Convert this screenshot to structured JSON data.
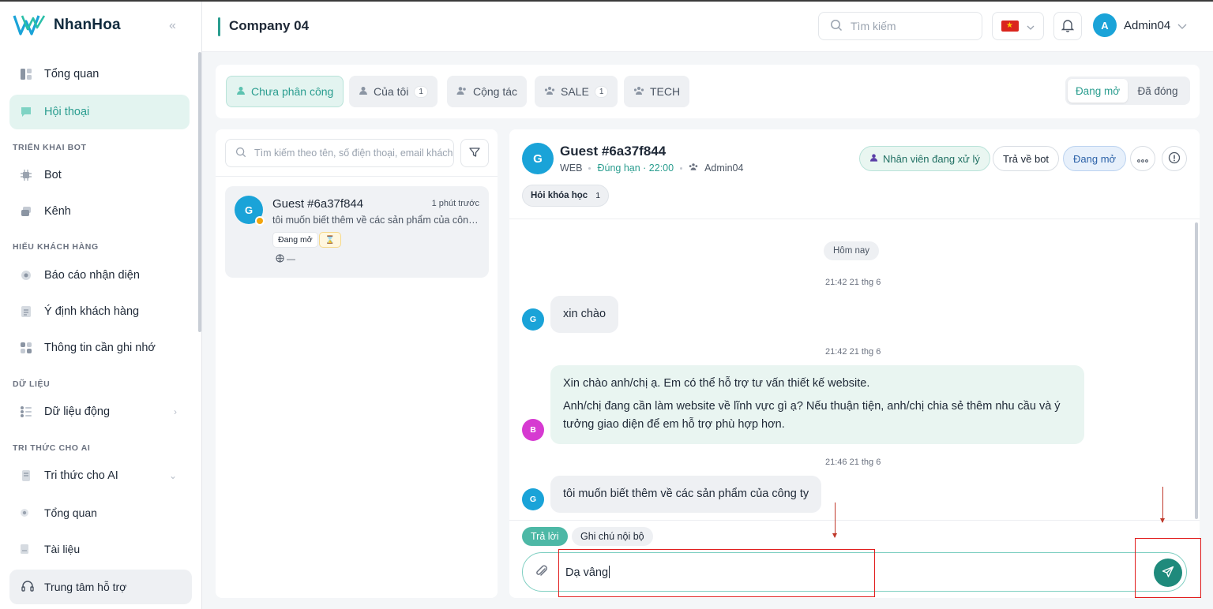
{
  "app": {
    "brand": "NhanHoa",
    "collapse_glyph": "«",
    "company": "Company 04"
  },
  "sidebar": {
    "items": [
      {
        "label": "Tổng quan",
        "icon": "dashboard-icon"
      },
      {
        "label": "Hội thoại",
        "icon": "chat-icon",
        "active": true
      }
    ],
    "sections": [
      {
        "title": "TRIỂN KHAI BOT",
        "items": [
          {
            "label": "Bot",
            "icon": "bot-icon"
          },
          {
            "label": "Kênh",
            "icon": "channel-icon"
          }
        ]
      },
      {
        "title": "HIỂU KHÁCH HÀNG",
        "items": [
          {
            "label": "Báo cáo nhận diện",
            "icon": "eye-icon"
          },
          {
            "label": "Ý định khách hàng",
            "icon": "intent-icon"
          },
          {
            "label": "Thông tin cần ghi nhớ",
            "icon": "grid-icon"
          }
        ]
      },
      {
        "title": "DỮ LIỆU",
        "items": [
          {
            "label": "Dữ liệu động",
            "icon": "dynamic-data-icon"
          }
        ]
      },
      {
        "title": "TRI THỨC CHO AI",
        "items": [
          {
            "label": "Tri thức cho AI",
            "icon": "knowledge-icon"
          },
          {
            "label": "Tổng quan",
            "icon": "dot-icon"
          },
          {
            "label": "Tài liệu",
            "icon": "document-icon"
          }
        ]
      }
    ],
    "support_label": "Trung tâm hỗ trợ"
  },
  "header": {
    "search_placeholder": "Tìm kiếm",
    "user_initial": "A",
    "user_name": "Admin04"
  },
  "filters": {
    "tabs": [
      {
        "label": "Chưa phân công",
        "count": "",
        "active": true
      },
      {
        "label": "Của tôi",
        "count": "1"
      },
      {
        "label": "Cộng tác",
        "count": ""
      },
      {
        "label": "SALE",
        "count": "1"
      },
      {
        "label": "TECH",
        "count": ""
      }
    ],
    "status_open": "Đang mở",
    "status_closed": "Đã đóng"
  },
  "list": {
    "search_placeholder": "Tìm kiếm theo tên, số điện thoại, email khách hàng",
    "conversations": [
      {
        "initial": "G",
        "name": "Guest #6a37f844",
        "time": "1 phút trước",
        "preview": "tôi muốn biết thêm về các sản phẩm của công ty",
        "status": "Đang mở",
        "waiting_glyph": "⌛",
        "channel": "—"
      }
    ]
  },
  "chat": {
    "guest_initial": "G",
    "guest_name": "Guest #6a37f844",
    "channel": "WEB",
    "sla": "Đúng hạn · 22:00",
    "assignee": "Admin04",
    "staff_button": "Nhân viên đang xử lý",
    "return_bot_button": "Trả về bot",
    "status_button": "Đang mở",
    "tag": {
      "label": "Hỏi khóa học",
      "count": "1"
    },
    "day_label": "Hôm nay",
    "messages": [
      {
        "time": "21:42 21 thg 6",
        "sender_initial": "G",
        "from": "guest",
        "paragraphs": [
          "xin chào"
        ]
      },
      {
        "time": "21:42 21 thg 6",
        "sender_initial": "B",
        "from": "bot",
        "paragraphs": [
          "Xin chào anh/chị ạ. Em có thể hỗ trợ tư vấn thiết kế website.",
          "Anh/chị đang cần làm website về lĩnh vực gì ạ? Nếu thuận tiện, anh/chị chia sẻ thêm nhu cầu và ý tưởng giao diện để em hỗ trợ phù hợp hơn."
        ]
      },
      {
        "time": "21:46 21 thg 6",
        "sender_initial": "G",
        "from": "guest",
        "paragraphs": [
          "tôi muốn biết thêm về các sản phẩm của công ty"
        ]
      }
    ],
    "reply_tab": "Trả lời",
    "note_tab": "Ghi chú nội bộ",
    "input_value": "Dạ vâng"
  },
  "colors": {
    "accent": "#2a9d8f",
    "accent_light": "#e3f4f0",
    "send": "#1f8a7c",
    "guest_avatar": "#1aa3d8",
    "bot_avatar": "#d63ad1",
    "annotation": "#e11d1d"
  }
}
